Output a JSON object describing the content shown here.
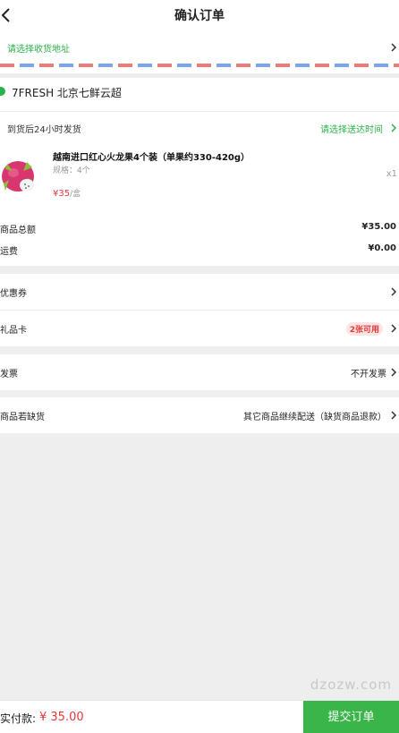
{
  "header": {
    "title": "确认订单",
    "back_icon": "back-chevron-icon"
  },
  "address": {
    "prompt": "请选择收货地址"
  },
  "store": {
    "name": "7FRESH  北京七鲜云超",
    "icon": "store-icon"
  },
  "shipping": {
    "label": "到货后24小时发货",
    "time_prompt": "请选择送达时间"
  },
  "product": {
    "name": "越南进口红心火龙果4个装（单果约330-420g）",
    "spec": "规格：4个",
    "quantity": "x1",
    "price": "¥35",
    "unit": "/盒"
  },
  "summary": {
    "total_label": "商品总额",
    "total_value": "¥35.00",
    "freight_label": "运费",
    "freight_value": "¥0.00"
  },
  "options": {
    "coupon_label": "优惠券",
    "giftcard_label": "礼品卡",
    "giftcard_badge": "2张可用",
    "invoice_label": "发票",
    "invoice_value": "不开发票",
    "stockout_label": "商品若缺货",
    "stockout_value": "其它商品继续配送（缺货商品退款）"
  },
  "footer": {
    "pay_label": "实付款:",
    "pay_value": "¥ 35.00",
    "submit_label": "提交订单"
  },
  "watermark": "dzozw.com",
  "colors": {
    "accent_green": "#2bb14a",
    "price_red": "#e6373a",
    "submit_green": "#39b54a"
  }
}
